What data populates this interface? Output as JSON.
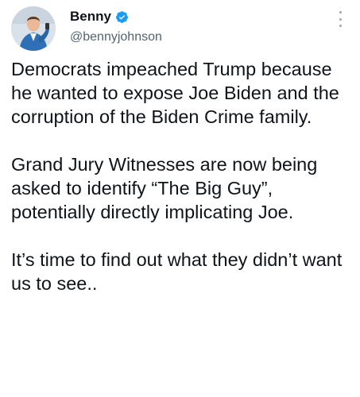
{
  "author": {
    "display_name": "Benny",
    "handle": "@bennyjohnson",
    "verified": true
  },
  "tweet": {
    "paragraphs": [
      "Democrats impeached Trump because he wanted to expose Joe Biden and the corruption of the Biden Crime family.",
      "Grand Jury Witnesses are now being asked to identify “The Big Guy”, potentially directly implicating Joe.",
      "It’s time to find out what they didn’t want us to see.."
    ]
  },
  "icons": {
    "verified": "verified-badge-icon",
    "more": "more-options-icon"
  },
  "colors": {
    "verified_badge": "#1d9bf0",
    "handle_text": "#536471",
    "body_text": "#0f1419"
  }
}
